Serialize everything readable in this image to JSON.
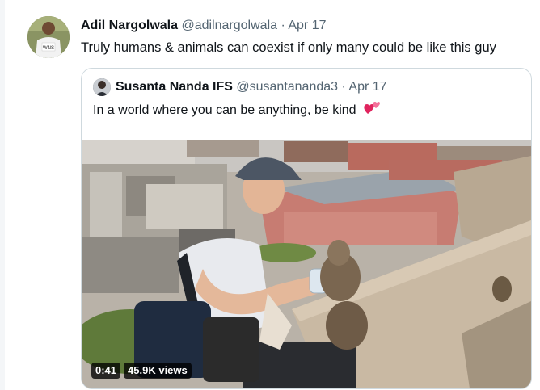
{
  "tweet": {
    "author_name": "Adil Nargolwala",
    "handle": "@adilnargolwala",
    "separator": "·",
    "date": "Apr 17",
    "text": "Truly humans & animals can coexist if only many could be like this guy",
    "avatar_jersey_text": "WNS"
  },
  "quoted_tweet": {
    "author_name": "Susanta Nanda IFS",
    "handle": "@susantananda3",
    "separator": "·",
    "date": "Apr 17",
    "text": "In a world where you can be anything, be kind",
    "emoji": "two-hearts"
  },
  "video": {
    "duration": "0:41",
    "views": "45.9K views"
  },
  "colors": {
    "text_primary": "#0f1419",
    "text_secondary": "#536471",
    "border": "#cfd9de",
    "heart": "#e0245e"
  }
}
